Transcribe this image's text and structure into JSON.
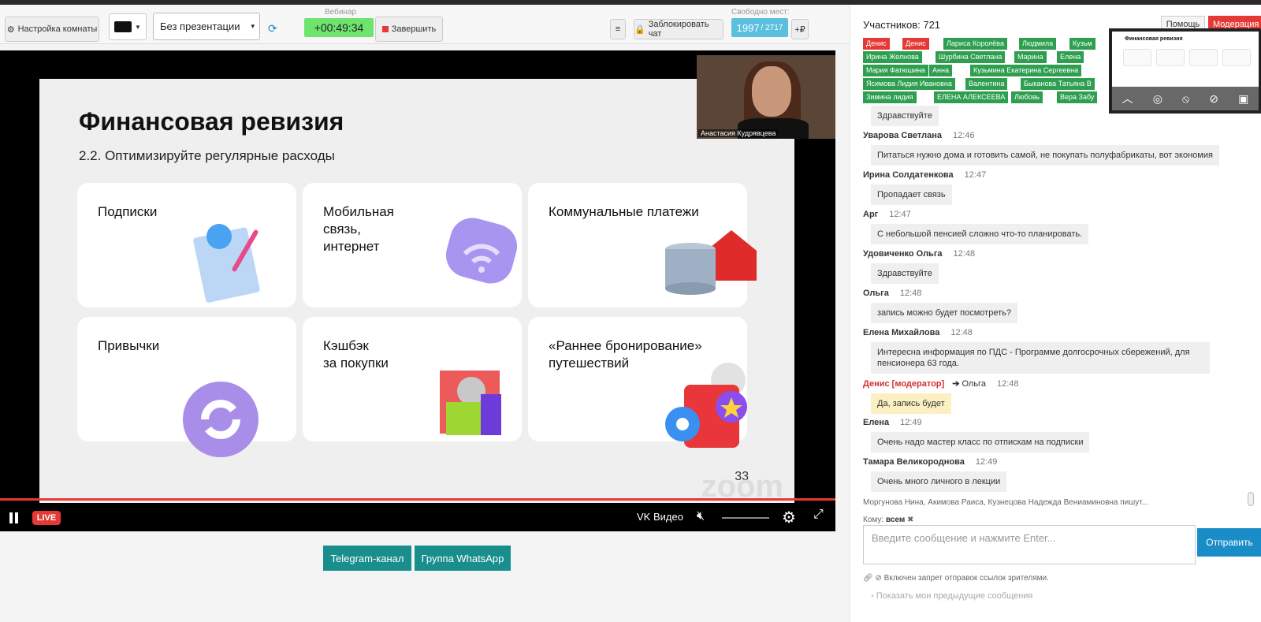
{
  "toolbar": {
    "room_settings_label": "Настройка комнаты",
    "presentation_select": "Без презентации",
    "webinar_label": "Вебинар",
    "timer": "+00:49:34",
    "finish_label": "Завершить",
    "lock_chat_label": "Заблокировать чат",
    "seats_label": "Свободно мест:",
    "seats_free": "1997",
    "seats_total": "/ 2717",
    "plus_label": "+₽"
  },
  "slide": {
    "title": "Финансовая ревизия",
    "subtitle": "2.2. Оптимизируйте регулярные расходы",
    "cards": [
      {
        "label": "Подписки"
      },
      {
        "label": "Мобильная\nсвязь,\nинтернет"
      },
      {
        "label": "Коммунальные платежи"
      },
      {
        "label": "Привычки"
      },
      {
        "label": "Кэшбэк\nза покупки"
      },
      {
        "label": "«Раннее бронирование»\nпутешествий"
      }
    ],
    "page_number": "33",
    "watermark": "zoom",
    "speaker_name": "Анастасия Кудрявцева"
  },
  "player": {
    "live_label": "LIVE",
    "provider": "VK Видео",
    "progress_fraction": 1.0
  },
  "links": {
    "telegram": "Telegram-канал",
    "whatsapp": "Группа WhatsApp"
  },
  "panel": {
    "participants": "Участников: 721",
    "help": "Помощь",
    "moderation": "Модерация",
    "tags": [
      {
        "name": "Денис",
        "red": true
      },
      {
        "name": "Денис",
        "red": true
      },
      {
        "name": "Лариса Королёва"
      },
      {
        "name": "Людмила"
      },
      {
        "name": "Кузьм"
      },
      {
        "name": "Ирина Желнова"
      },
      {
        "name": "Шурбина Светлана"
      },
      {
        "name": "Марина"
      },
      {
        "name": "Елена"
      },
      {
        "name": "Мария Фатюшина"
      },
      {
        "name": "Анна"
      },
      {
        "name": "Кузьмина Екатерина Сергеевна"
      },
      {
        "name": "Ясимова Лидия Ивановна"
      },
      {
        "name": "Валентина"
      },
      {
        "name": "Быканова Татьяна В"
      },
      {
        "name": "Зимина лидия"
      },
      {
        "name": "ЕЛЕНА АЛЕКСЕЕВА"
      },
      {
        "name": "Любовь"
      },
      {
        "name": "Вера Забу"
      }
    ],
    "thumb_title": "Финансовая ревизия"
  },
  "chat": {
    "messages": [
      {
        "author": "",
        "time": "",
        "text": "Здравствуйте"
      },
      {
        "author": "Уварова Светлана",
        "time": "12:46",
        "text": "Питаться нужно дома и готовить самой, не покупать полуфабрикаты, вот экономия"
      },
      {
        "author": "Ирина Солдатенкова",
        "time": "12:47",
        "text": "Пропадает связь"
      },
      {
        "author": "Арг",
        "time": "12:47",
        "text": "С небольшой пенсией сложно что-то планировать."
      },
      {
        "author": "Удовиченко Ольга",
        "time": "12:48",
        "text": "Здравствуйте"
      },
      {
        "author": "Ольга",
        "time": "12:48",
        "text": "запись можно будет посмотреть?"
      },
      {
        "author": "Елена Михайлова",
        "time": "12:48",
        "text": "Интересна информация по ПДС - Программе долгосрочных сбережений, для пенсионера 63 года."
      },
      {
        "author": "Денис [модератор]",
        "to": "Ольга",
        "time": "12:48",
        "text": "Да, запись будет",
        "mod": true
      },
      {
        "author": "Елена",
        "time": "12:49",
        "text": "Очень надо мастер класс по отпискам на подписки"
      },
      {
        "author": "Тамара Великороднова",
        "time": "12:49",
        "text": "Очень много личного в лекции"
      }
    ],
    "typing": "Моргунова Нина, Акимова Раиса, Кузнецова Надежда Вениаминовна пишут...",
    "to_label": "Кому:",
    "to_value": "всем",
    "input_placeholder": "Введите сообщение и нажмите Enter...",
    "send_label": "Отправить",
    "note": "Включен запрет отправок ссылок зрителями.",
    "prev_link": "Показать мои предыдущие сообщения"
  }
}
